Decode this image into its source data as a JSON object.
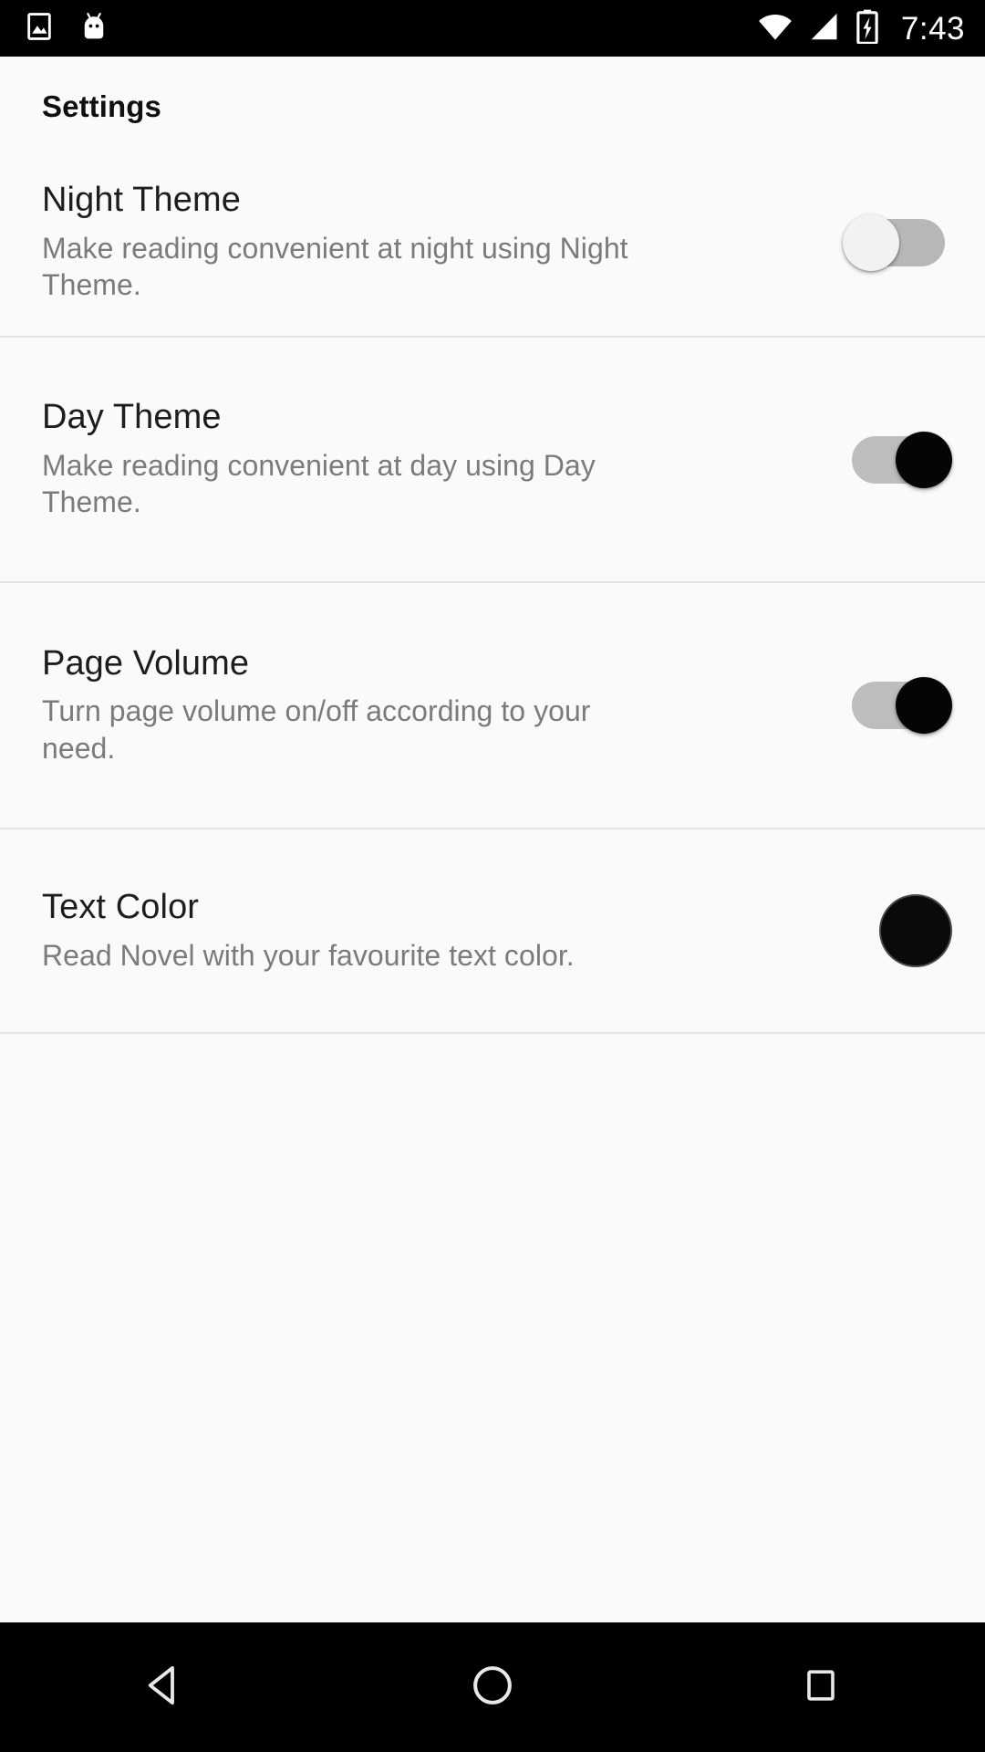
{
  "status_bar": {
    "left_icons": [
      {
        "name": "image-notification-icon",
        "glyph": "image"
      },
      {
        "name": "android-head-icon",
        "glyph": "android"
      }
    ],
    "right_icons": [
      {
        "name": "wifi-icon",
        "glyph": "wifi"
      },
      {
        "name": "cellular-signal-icon",
        "glyph": "signal"
      },
      {
        "name": "battery-charging-icon",
        "glyph": "battery-charging"
      }
    ],
    "clock": "7:43",
    "background_color": "#000000",
    "foreground_color": "#ffffff"
  },
  "header": {
    "title": "Settings"
  },
  "settings": {
    "rows": [
      {
        "id": "night-theme",
        "title": "Night Theme",
        "subtitle": "Make reading convenient at night using Night Theme.",
        "control": "switch",
        "state": "off",
        "state_label": "Off"
      },
      {
        "id": "day-theme",
        "title": "Day Theme",
        "subtitle": "Make reading convenient at day using Day Theme.",
        "control": "switch",
        "state": "on",
        "state_label": "On"
      },
      {
        "id": "page-volume",
        "title": "Page Volume",
        "subtitle": "Turn page volume on/off according to your need.",
        "control": "switch",
        "state": "on",
        "state_label": "On"
      },
      {
        "id": "text-color",
        "title": "Text Color",
        "subtitle": "Read Novel with your favourite text color.",
        "control": "color-swatch",
        "state": "#0a0a0a",
        "state_label": "Black"
      }
    ]
  },
  "nav_bar": {
    "buttons": [
      {
        "name": "back-button",
        "icon": "back-triangle-icon"
      },
      {
        "name": "home-button",
        "icon": "home-circle-icon"
      },
      {
        "name": "recents-button",
        "icon": "recents-square-icon"
      }
    ],
    "background_color": "#000000"
  },
  "colors": {
    "page_background": "#fafafa",
    "title_text": "#1d1d1d",
    "subtitle_text": "#7b7b7b",
    "divider": "#e4e4e4",
    "switch_track": "#b9b9b9",
    "switch_thumb_on": "#050505",
    "switch_thumb_off": "#f2f2f2"
  }
}
